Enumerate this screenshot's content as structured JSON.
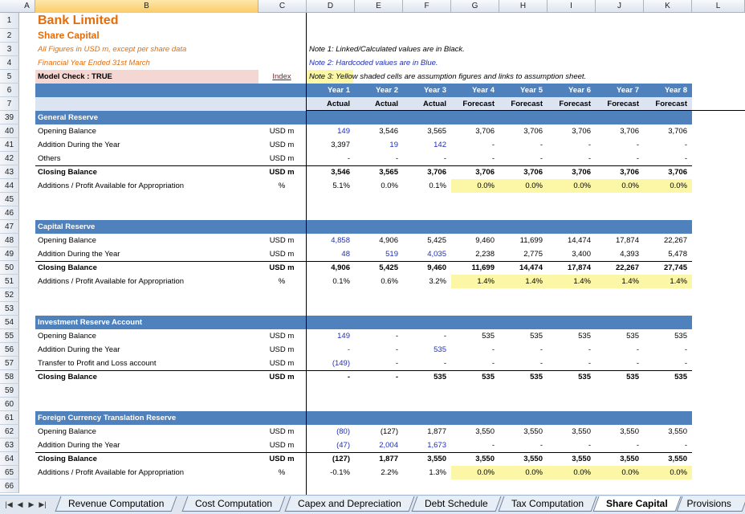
{
  "columns": [
    "A",
    "B",
    "C",
    "D",
    "E",
    "F",
    "G",
    "H",
    "I",
    "J",
    "K",
    "L"
  ],
  "header": {
    "title": "Bank Limited",
    "subtitle": "Share Capital",
    "figures_note": "All Figures in USD m, except per share data",
    "year_note": "Financial Year Ended 31st March",
    "model_check": "Model Check : TRUE",
    "index_link": "Index",
    "note1": "Note 1: Linked/Calculated values are in Black.",
    "note2": "Note 2: Hardcoded values are in Blue.",
    "note3": "Note 3: Yellow shaded cells are assumption figures and links to assumption sheet."
  },
  "years": [
    "Year 1",
    "Year 2",
    "Year 3",
    "Year 4",
    "Year 5",
    "Year 6",
    "Year 7",
    "Year 8"
  ],
  "periods": [
    "Actual",
    "Actual",
    "Actual",
    "Forecast",
    "Forecast",
    "Forecast",
    "Forecast",
    "Forecast"
  ],
  "rows": [
    {
      "n": "39",
      "type": "section",
      "label": "General Reserve"
    },
    {
      "n": "40",
      "label": "Opening Balance",
      "unit": "USD m",
      "v": [
        "149",
        "3,546",
        "3,565",
        "3,706",
        "3,706",
        "3,706",
        "3,706",
        "3,706"
      ],
      "blue": [
        0
      ]
    },
    {
      "n": "41",
      "label": "Addition During the Year",
      "unit": "USD m",
      "v": [
        "3,397",
        "19",
        "142",
        "-",
        "-",
        "-",
        "-",
        "-"
      ],
      "blue": [
        1,
        2
      ]
    },
    {
      "n": "42",
      "label": "Others",
      "unit": "USD m",
      "v": [
        "-",
        "-",
        "-",
        "-",
        "-",
        "-",
        "-",
        "-"
      ]
    },
    {
      "n": "43",
      "label": "Closing Balance",
      "unit": "USD m",
      "bold": true,
      "line": true,
      "v": [
        "3,546",
        "3,565",
        "3,706",
        "3,706",
        "3,706",
        "3,706",
        "3,706",
        "3,706"
      ]
    },
    {
      "n": "44",
      "label": "Additions / Profit Available for Appropriation",
      "unit": "%",
      "v": [
        "5.1%",
        "0.0%",
        "0.1%",
        "0.0%",
        "0.0%",
        "0.0%",
        "0.0%",
        "0.0%"
      ],
      "yellow": true
    },
    {
      "n": "45",
      "type": "blank"
    },
    {
      "n": "46",
      "type": "blank"
    },
    {
      "n": "47",
      "type": "section",
      "label": "Capital Reserve"
    },
    {
      "n": "48",
      "label": "Opening Balance",
      "unit": "USD m",
      "v": [
        "4,858",
        "4,906",
        "5,425",
        "9,460",
        "11,699",
        "14,474",
        "17,874",
        "22,267"
      ],
      "blue": [
        0
      ]
    },
    {
      "n": "49",
      "label": "Addition During the Year",
      "unit": "USD m",
      "v": [
        "48",
        "519",
        "4,035",
        "2,238",
        "2,775",
        "3,400",
        "4,393",
        "5,478"
      ],
      "blue": [
        0,
        1,
        2
      ]
    },
    {
      "n": "50",
      "label": "Closing Balance",
      "unit": "USD m",
      "bold": true,
      "line": true,
      "v": [
        "4,906",
        "5,425",
        "9,460",
        "11,699",
        "14,474",
        "17,874",
        "22,267",
        "27,745"
      ]
    },
    {
      "n": "51",
      "label": "Additions / Profit Available for Appropriation",
      "unit": "%",
      "v": [
        "0.1%",
        "0.6%",
        "3.2%",
        "1.4%",
        "1.4%",
        "1.4%",
        "1.4%",
        "1.4%"
      ],
      "yellow": true
    },
    {
      "n": "52",
      "type": "blank"
    },
    {
      "n": "53",
      "type": "blank"
    },
    {
      "n": "54",
      "type": "section",
      "label": "Investment Reserve Account"
    },
    {
      "n": "55",
      "label": "Opening Balance",
      "unit": "USD m",
      "v": [
        "149",
        "-",
        "-",
        "535",
        "535",
        "535",
        "535",
        "535"
      ],
      "blue": [
        0
      ]
    },
    {
      "n": "56",
      "label": "Addition During the Year",
      "unit": "USD m",
      "v": [
        "-",
        "-",
        "535",
        "-",
        "-",
        "-",
        "-",
        "-"
      ],
      "blue": [
        0,
        2
      ]
    },
    {
      "n": "57",
      "label": "Transfer to Profit and Loss account",
      "unit": "USD m",
      "v": [
        "(149)",
        "-",
        "-",
        "-",
        "-",
        "-",
        "-",
        "-"
      ],
      "blue": [
        0
      ]
    },
    {
      "n": "58",
      "label": "Closing Balance",
      "unit": "USD m",
      "bold": true,
      "line": true,
      "v": [
        "-",
        "-",
        "535",
        "535",
        "535",
        "535",
        "535",
        "535"
      ]
    },
    {
      "n": "59",
      "type": "blank"
    },
    {
      "n": "60",
      "type": "blank"
    },
    {
      "n": "61",
      "type": "section",
      "label": "Foreign Currency Translation Reserve"
    },
    {
      "n": "62",
      "label": "Opening Balance",
      "unit": "USD m",
      "v": [
        "(80)",
        "(127)",
        "1,877",
        "3,550",
        "3,550",
        "3,550",
        "3,550",
        "3,550"
      ],
      "blue": [
        0
      ]
    },
    {
      "n": "63",
      "label": "Addition During the Year",
      "unit": "USD m",
      "v": [
        "(47)",
        "2,004",
        "1,673",
        "-",
        "-",
        "-",
        "-",
        "-"
      ],
      "blue": [
        0,
        1,
        2
      ]
    },
    {
      "n": "64",
      "label": "Closing Balance",
      "unit": "USD m",
      "bold": true,
      "line": true,
      "v": [
        "(127)",
        "1,877",
        "3,550",
        "3,550",
        "3,550",
        "3,550",
        "3,550",
        "3,550"
      ]
    },
    {
      "n": "65",
      "label": "Additions / Profit Available for Appropriation",
      "unit": "%",
      "v": [
        "-0.1%",
        "2.2%",
        "1.3%",
        "0.0%",
        "0.0%",
        "0.0%",
        "0.0%",
        "0.0%"
      ],
      "yellow": true
    },
    {
      "n": "66",
      "type": "blank"
    }
  ],
  "row_numbers_top": [
    "1",
    "2",
    "3",
    "4",
    "5",
    "6",
    "7"
  ],
  "tabs": [
    "Revenue Computation",
    "Cost Computation",
    "Capex and Depreciation",
    "Debt Schedule",
    "Tax Computation",
    "Share Capital",
    "Provisions a"
  ],
  "active_tab": "Share Capital",
  "nav_icons": [
    "first-sheet-icon",
    "prev-sheet-icon",
    "next-sheet-icon",
    "last-sheet-icon"
  ],
  "colors": {
    "section": "#4f81bd",
    "hardcoded": "#1f2fb8",
    "assumption": "#fbf7a6",
    "title": "#e46c0a"
  }
}
